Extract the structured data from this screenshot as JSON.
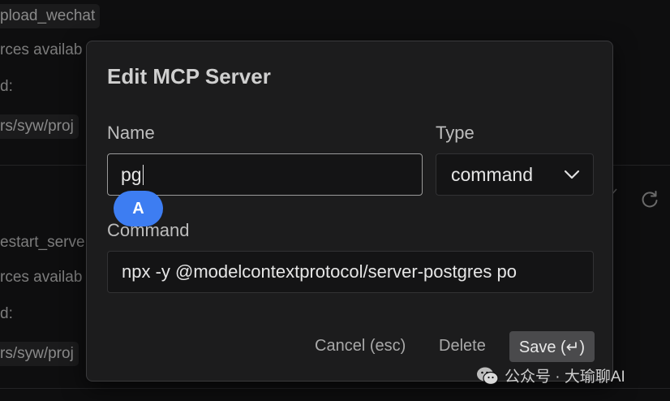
{
  "background": {
    "items": [
      "pload_wechat",
      "rces availab",
      "d:",
      "rs/syw/proj",
      "estart_serve",
      "rces availab",
      "d:",
      "rs/syw/proj"
    ]
  },
  "dialog": {
    "title": "Edit MCP Server",
    "name_label": "Name",
    "name_value": "pg",
    "type_label": "Type",
    "type_value": "command",
    "command_label": "Command",
    "command_value": "npx -y @modelcontextprotocol/server-postgres po",
    "cancel_label": "Cancel (esc)",
    "delete_label": "Delete",
    "save_label": "Save (↵)"
  },
  "avatar": {
    "letter": "A",
    "color": "#3d7df2"
  },
  "watermark": {
    "text": "公众号 · 大瑜聊AI"
  },
  "colors": {
    "dialog_bg": "#1c1c1d",
    "input_bg": "#141415",
    "accent": "#3d7df2",
    "save_button_bg": "#4a4a4c"
  }
}
